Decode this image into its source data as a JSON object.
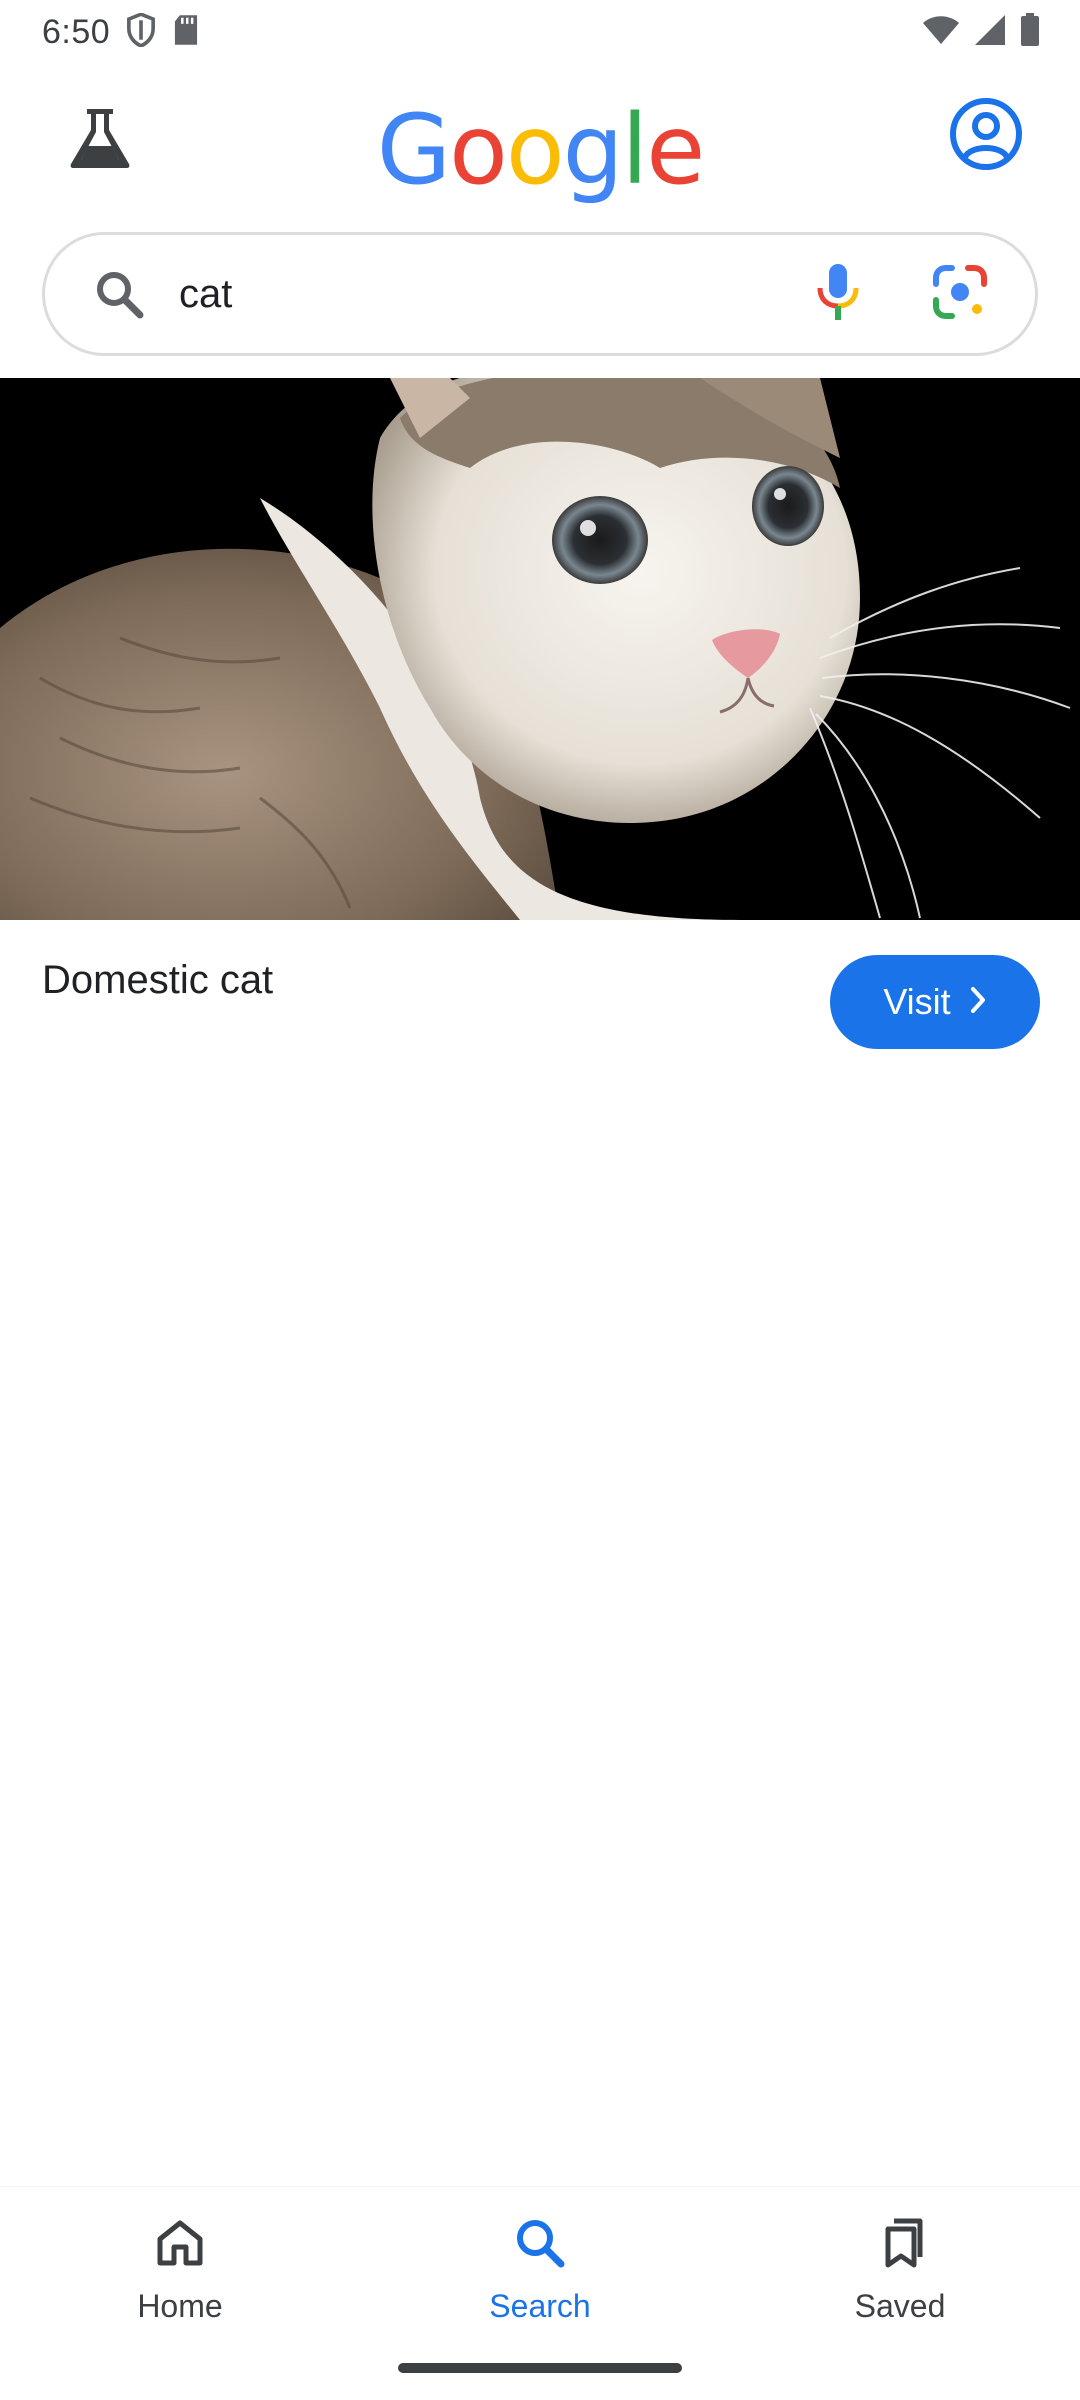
{
  "status_bar": {
    "time": "6:50",
    "icons_left": [
      "shield-icon",
      "sd-card-icon"
    ],
    "icons_right": [
      "wifi-icon",
      "cellular-signal-icon",
      "battery-icon"
    ]
  },
  "header": {
    "logo_text": "Google",
    "logo_colors": [
      "#4285F4",
      "#EA4335",
      "#FBBC05",
      "#4285F4",
      "#34A853",
      "#EA4335"
    ],
    "left_icon": "labs-flask-icon",
    "right_icon": "account-circle-icon"
  },
  "search": {
    "value": "cat",
    "icon": "search-icon",
    "mic_icon": "mic-icon",
    "lens_icon": "google-lens-icon"
  },
  "result": {
    "image_subject": "cat photo",
    "title": "Domestic cat",
    "visit_label": "Visit"
  },
  "bottom_nav": {
    "items": [
      {
        "label": "Home",
        "icon": "home-icon",
        "active": false
      },
      {
        "label": "Search",
        "icon": "search-icon",
        "active": true
      },
      {
        "label": "Saved",
        "icon": "bookmarks-icon",
        "active": false
      }
    ]
  },
  "colors": {
    "accent": "#1a73e8",
    "text_primary": "#202124",
    "text_secondary": "#3c4043",
    "border": "#dadce0"
  }
}
